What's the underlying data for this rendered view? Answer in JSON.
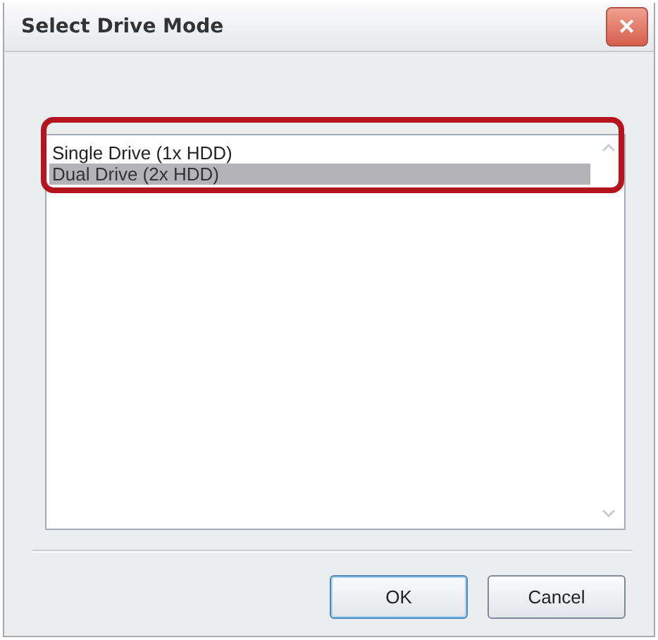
{
  "window": {
    "title": "Select Drive Mode",
    "close": "✕"
  },
  "list": {
    "items": [
      {
        "label": "Single Drive (1x HDD)",
        "selected": false
      },
      {
        "label": "Dual Drive (2x HDD)",
        "selected": true
      }
    ]
  },
  "buttons": [
    "OK",
    "Cancel"
  ]
}
